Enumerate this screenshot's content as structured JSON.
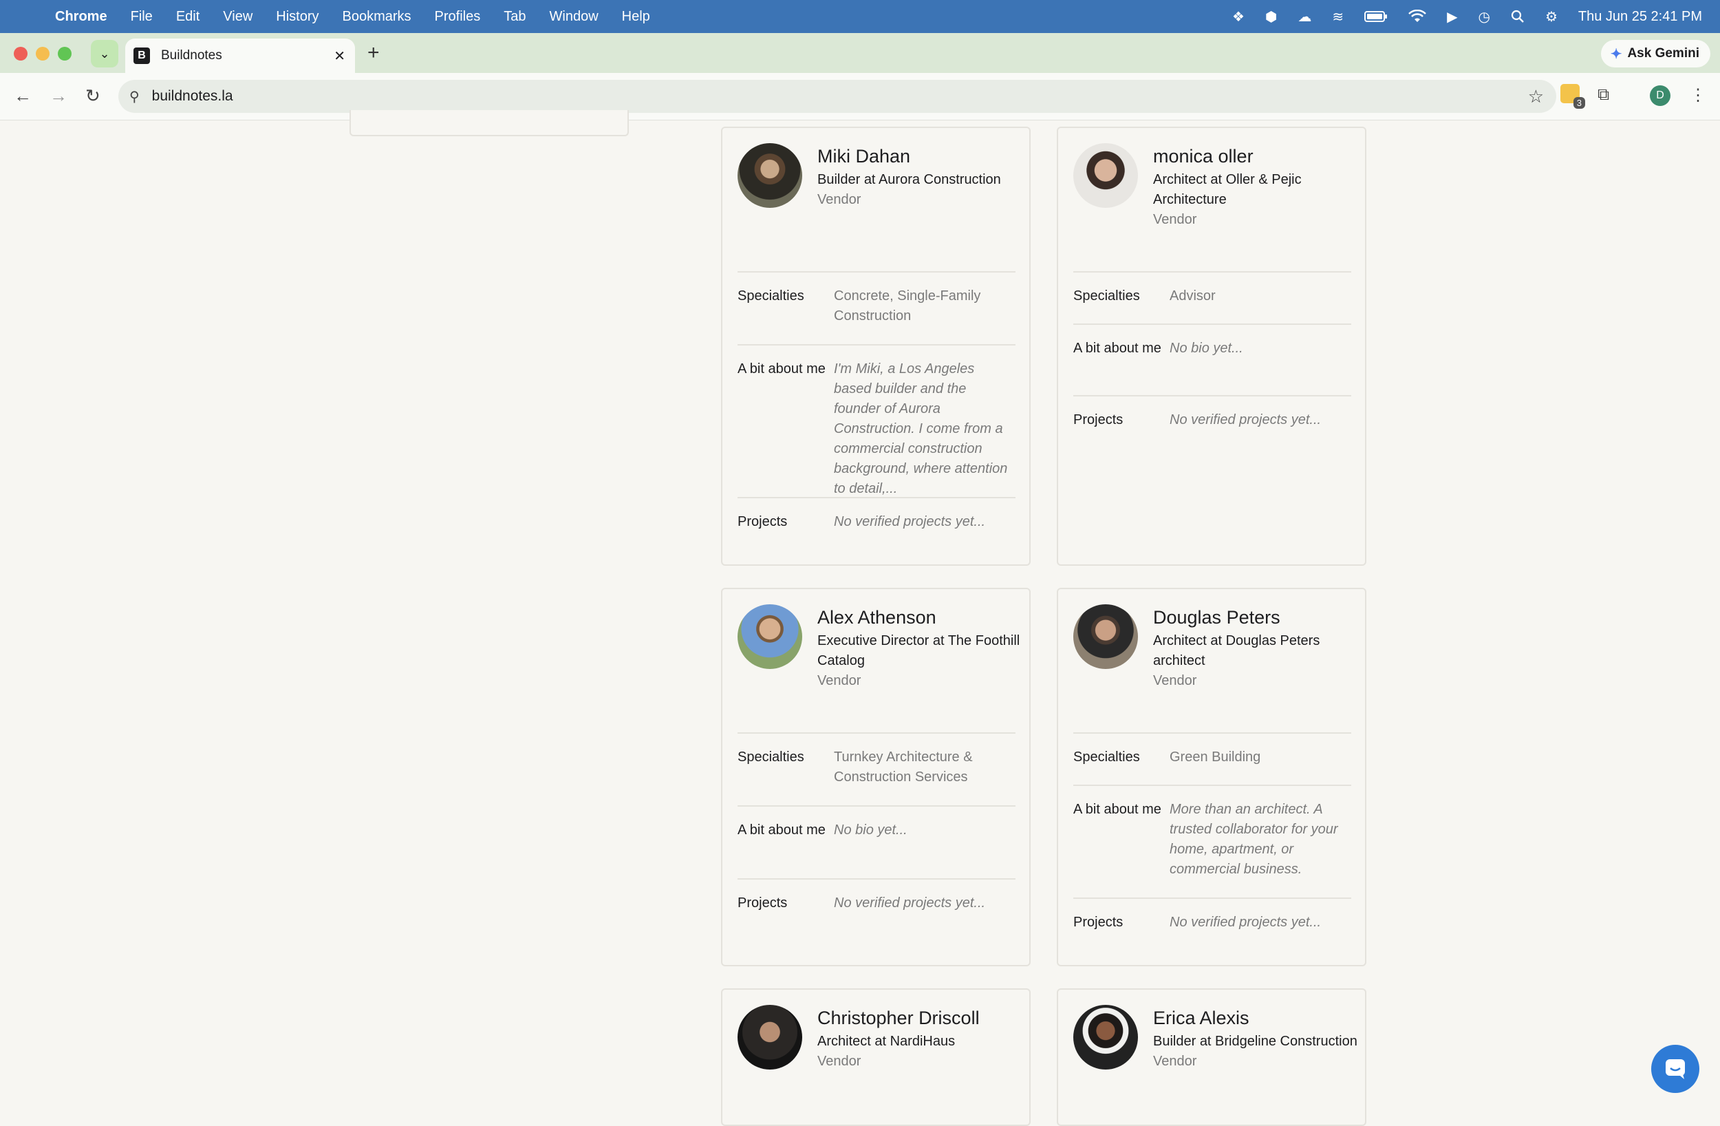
{
  "menubar": {
    "app": "Chrome",
    "items": [
      "File",
      "Edit",
      "View",
      "History",
      "Bookmarks",
      "Profiles",
      "Tab",
      "Window",
      "Help"
    ],
    "clock": "Thu Jun 25  2:41 PM"
  },
  "browser": {
    "tab_title": "Buildnotes",
    "favicon_letter": "B",
    "ask_gemini": "Ask Gemini",
    "url": "buildnotes.la",
    "ext_badge": "3",
    "profile_letter": "D"
  },
  "cards": [
    {
      "name": "Miki Dahan",
      "role": "Builder at Aurora Construction",
      "type": "Vendor",
      "specialties_label": "Specialties",
      "specialties": "Concrete, Single-Family Construction",
      "bio_label": "A bit about me",
      "bio": "I'm Miki, a Los Angeles based builder and the founder of Aurora Construction. I come from a commercial construction background, where attention to detail,...",
      "projects_label": "Projects",
      "projects": "No verified projects yet..."
    },
    {
      "name": "monica oller",
      "role": "Architect at Oller & Pejic Architecture",
      "type": "Vendor",
      "specialties_label": "Specialties",
      "specialties": "Advisor",
      "bio_label": "A bit about me",
      "bio": "No bio yet...",
      "projects_label": "Projects",
      "projects": "No verified projects yet..."
    },
    {
      "name": "Alex Athenson",
      "role": "Executive Director at The Foothill Catalog",
      "type": "Vendor",
      "specialties_label": "Specialties",
      "specialties": "Turnkey Architecture & Construction Services",
      "bio_label": "A bit about me",
      "bio": "No bio yet...",
      "projects_label": "Projects",
      "projects": "No verified projects yet..."
    },
    {
      "name": "Douglas Peters",
      "role": "Architect at Douglas Peters architect",
      "type": "Vendor",
      "specialties_label": "Specialties",
      "specialties": "Green Building",
      "bio_label": "A bit about me",
      "bio": "More than an architect. A trusted collaborator for your home, apartment, or commercial business.",
      "projects_label": "Projects",
      "projects": "No verified projects yet..."
    },
    {
      "name": "Christopher Driscoll",
      "role": "Architect at NardiHaus",
      "type": "Vendor"
    },
    {
      "name": "Erica Alexis",
      "role": "Builder at Bridgeline Construction",
      "type": "Vendor"
    }
  ]
}
